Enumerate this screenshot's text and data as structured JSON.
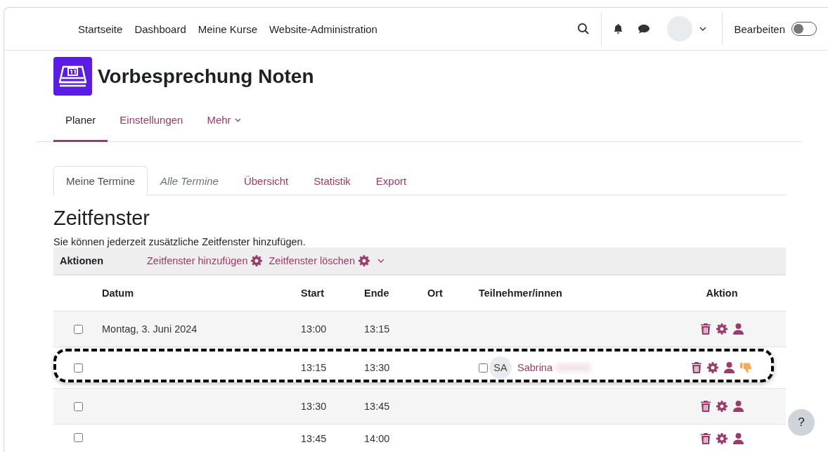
{
  "topnav": {
    "items": [
      {
        "label": "Startseite"
      },
      {
        "label": "Dashboard"
      },
      {
        "label": "Meine Kurse"
      },
      {
        "label": "Website-Administration"
      }
    ],
    "edit_mode": {
      "label": "Bearbeiten",
      "on": false
    }
  },
  "course": {
    "title": "Vorbesprechung Noten"
  },
  "secondary_nav": [
    {
      "label": "Planer",
      "selected": true,
      "has_menu": false
    },
    {
      "label": "Einstellungen",
      "selected": false,
      "has_menu": false
    },
    {
      "label": "Mehr",
      "selected": false,
      "has_menu": true
    }
  ],
  "tabs": [
    {
      "label": "Meine Termine",
      "selected": true,
      "italic": false
    },
    {
      "label": "Alle Termine",
      "selected": false,
      "italic": true
    },
    {
      "label": "Übersicht",
      "selected": false,
      "italic": false
    },
    {
      "label": "Statistik",
      "selected": false,
      "italic": false
    },
    {
      "label": "Export",
      "selected": false,
      "italic": false
    }
  ],
  "heading": "Zeitfenster",
  "intro": "Sie können jederzeit zusätzliche Zeitfenster hinzufügen.",
  "actions_bar": {
    "label": "Aktionen",
    "links": [
      {
        "label": "Zeitfenster hinzufügen"
      },
      {
        "label": "Zeitfenster löschen"
      }
    ]
  },
  "table": {
    "columns": [
      "Datum",
      "Start",
      "Ende",
      "Ort",
      "Teilnehmer/innen",
      "Aktion"
    ],
    "rows": [
      {
        "checked": false,
        "date": "Montag, 3. Juni 2024",
        "start": "13:00",
        "end": "13:15",
        "highlighted": false,
        "participants": [],
        "actions": [
          {
            "kind": "delete"
          },
          {
            "kind": "settings"
          },
          {
            "kind": "user"
          }
        ]
      },
      {
        "checked": false,
        "start": "13:15",
        "end": "13:30",
        "highlighted": true,
        "participants": [
          {
            "initials": "SA",
            "name": "Sabrina",
            "checked": false
          }
        ],
        "actions": [
          {
            "kind": "delete"
          },
          {
            "kind": "settings"
          },
          {
            "kind": "user"
          },
          {
            "kind": "thumbs-down"
          }
        ]
      },
      {
        "checked": false,
        "start": "13:30",
        "end": "13:45",
        "highlighted": false,
        "participants": [],
        "actions": [
          {
            "kind": "delete"
          },
          {
            "kind": "settings"
          },
          {
            "kind": "user"
          }
        ]
      },
      {
        "checked": false,
        "start": "13:45",
        "end": "14:00",
        "highlighted": false,
        "participants": [],
        "actions": [
          {
            "kind": "delete"
          },
          {
            "kind": "settings"
          },
          {
            "kind": "user"
          }
        ]
      }
    ]
  },
  "help": {
    "label": "?"
  }
}
